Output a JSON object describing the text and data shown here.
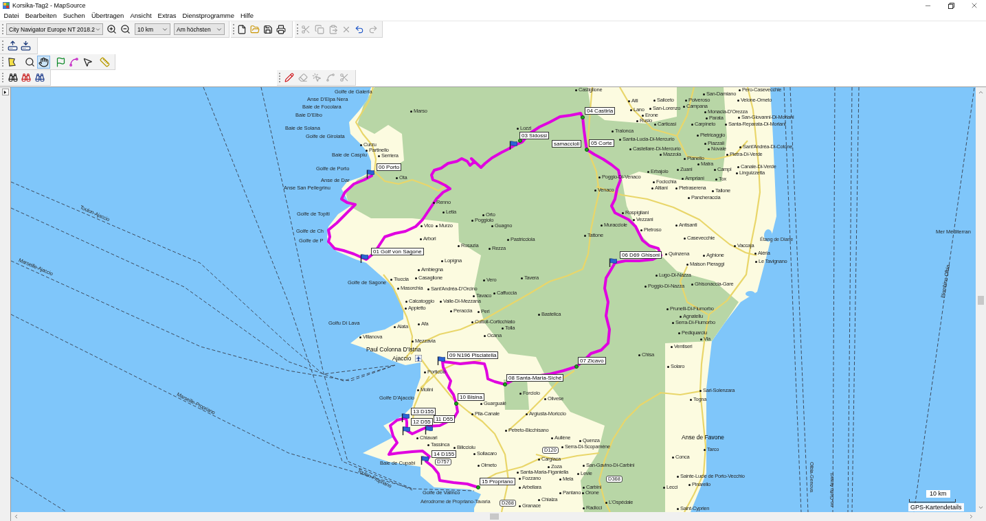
{
  "window": {
    "title": "Korsika-Tag2 - MapSource"
  },
  "menu": [
    "Datei",
    "Bearbeiten",
    "Suchen",
    "Übertragen",
    "Ansicht",
    "Extras",
    "Dienstprogramme",
    "Hilfe"
  ],
  "toolbar": {
    "map_product": "City Navigator Europe NT 2018.2",
    "zoom_scale": "10 km",
    "detail": "Am höchsten"
  },
  "edit_tools": [
    {
      "disabled": true
    },
    {
      "disabled": true
    },
    {
      "disabled": true
    },
    {
      "disabled": true
    },
    {
      "disabled": false
    },
    {
      "disabled": true
    }
  ],
  "map_tools": [
    {
      "selected": false
    },
    {
      "selected": false
    },
    {
      "selected": true
    },
    {
      "selected": false
    },
    {
      "selected": false
    },
    {
      "selected": false
    },
    {
      "selected": false
    }
  ],
  "track_tools": [
    {
      "disabled": false
    },
    {
      "disabled": true
    },
    {
      "disabled": true
    },
    {
      "disabled": true
    },
    {
      "disabled": true
    }
  ],
  "map": {
    "ferry_routes": [
      "Toulon-Ajaccio",
      "Marseille-Ajaccio",
      "Marseille-Propriano",
      "Toulon-Propriano",
      "Olbia-Genova",
      "no-Golfo Aranci",
      "Piombino-Olbia"
    ],
    "area_labels": [
      {
        "text": "Golfe de Galeria",
        "kind": "water"
      },
      {
        "text": "Anse D'Elpa Nera",
        "kind": "water"
      },
      {
        "text": "Baie de Focolara",
        "kind": "water"
      },
      {
        "text": "Baie D'Elbo",
        "kind": "water"
      },
      {
        "text": "Baie de Solana",
        "kind": "water"
      },
      {
        "text": "Golfe de Girolata",
        "kind": "water"
      },
      {
        "text": "Baie de Caspiu",
        "kind": "water"
      },
      {
        "text": "Golfe de Porto",
        "kind": "water"
      },
      {
        "text": "Anse de Dar",
        "kind": "water"
      },
      {
        "text": "Anse San Pellegrinu",
        "kind": "water"
      },
      {
        "text": "Golfe de Topiti",
        "kind": "water"
      },
      {
        "text": "Golfe de Ch",
        "kind": "water"
      },
      {
        "text": "Mer Méditerran",
        "kind": "water"
      },
      {
        "text": "Golfe de P",
        "kind": "water"
      },
      {
        "text": "Étang de Diane",
        "kind": "small"
      },
      {
        "text": "Golfe de Sagone",
        "kind": "water"
      },
      {
        "text": "Golfu Di Lava",
        "kind": "water"
      },
      {
        "text": "Paul Colonna D'Istria",
        "kind": "place"
      },
      {
        "text": "Ajaccio",
        "kind": "place"
      },
      {
        "text": "Golfe D'Ajaccio",
        "kind": "water"
      },
      {
        "text": "Anse de Favone",
        "kind": "place"
      },
      {
        "text": "Baie de Cupabi",
        "kind": "water"
      },
      {
        "text": "Golfe de Valinco",
        "kind": "water"
      },
      {
        "text": "Aérodrome de Propriano-Tavaria",
        "kind": "small"
      }
    ],
    "towns": [
      "Castiglione",
      "San-Damiano",
      "Pero-Casevecchie",
      "Aiti",
      "Saliceto",
      "Polveroso",
      "Velone-Orneto",
      "Marso",
      "Lano",
      "San-Lorenzo",
      "Campana",
      "Erone",
      "Monacia-D'Orezza",
      "Rusio",
      "Parata",
      "San-Giovanni-Di-Moriani",
      "Lozzi",
      "Carticasi",
      "Carpineto",
      "Santa-Reparata-Di-Moriani",
      "Tralonca",
      "Santa-Lucia-Di-Mercurio",
      "Pietricaggio",
      "Curzu",
      "Piazzali",
      "Partinello",
      "Castellare-Di-Mercurio",
      "Novale",
      "Sant'Andréa-Di-Cotone",
      "Serriera",
      "Mazzola",
      "Pianello",
      "Pietra-Di-Verde",
      "Matra",
      "Erbajolo",
      "Zuani",
      "Campi",
      "Canale-Di-Verde",
      "Ota",
      "Poggio-Di-Venaco",
      "Linguizzetta",
      "Focicchia",
      "Ampriani",
      "Tox",
      "Venaco",
      "Altiani",
      "Pietraserena",
      "Tallone",
      "Renno",
      "Pancheraccia",
      "Letia",
      "Orto",
      "Rospigliani",
      "Poggiolo",
      "Vezzani",
      "Vico",
      "Murzo",
      "Guagno",
      "Muracciole",
      "Pietroso",
      "Antisanti",
      "Arbori",
      "Pastricciola",
      "Tattone",
      "Casevecchie",
      "Rosazia",
      "Rezza",
      "Vaccaja",
      "Quinzena",
      "Aghione",
      "Aléria",
      "Lopigna",
      "Maison Pieraggi",
      "Le Tavignano",
      "Ambiegna",
      "Tiuccia",
      "Casaglione",
      "Vero",
      "Tavera",
      "Lugo-Di-Nazza",
      "Masorchia",
      "Sant'Andréa-D'Orcino",
      "Poggio-Di-Nazza",
      "Ghisonaccia-Gare",
      "Tavaco",
      "Caffuccia",
      "Calcatoggio",
      "Valle-Di-Mezzana",
      "Appietto",
      "Peraccia",
      "Peri",
      "Prunelli-Di-Fiumorbo",
      "Bastelica",
      "Agnatellu",
      "Alata",
      "Afa",
      "Cuttoli-Corticchiato",
      "Serra-Di-Fiumorbo",
      "Tolla",
      "Villanova",
      "Ocana",
      "Pediquarciu",
      "Mezzavia",
      "Via",
      "Ventiseri",
      "Chisa",
      "Solaro",
      "Porticcio",
      "Molini",
      "Forciolo",
      "Sari-Solenzara",
      "Guargualé",
      "Olivese",
      "Togna",
      "Pila-Canale",
      "Argiusta-Moriccio",
      "Petreto-Bicchisano",
      "Chiavari",
      "Aullène",
      "Tassinca",
      "Quenza",
      "Bilicciolu",
      "Serra-Di-Scopamène",
      "Sollacaro",
      "Tarco",
      "Cargiaca",
      "Conca",
      "Olmeto",
      "Zoza",
      "San-Gavino-Di-Carbini",
      "Santa-Maria-Figaniella",
      "Fozzano",
      "Levie",
      "Mela",
      "Sainte-Lucie de Porto-Vecchio",
      "Arbellara",
      "Carbini",
      "Lecci",
      "Pinarello",
      "Pantano",
      "Orone",
      "Chialza",
      "Granace",
      "L'Ospédale",
      "Radicci",
      "Saint-Cyprien"
    ],
    "road_numbers": [
      "D120",
      "D757",
      "D368",
      "D268"
    ],
    "waypoints": [
      {
        "label": "00 Porto",
        "kind": "flag"
      },
      {
        "label": "01 Golf von Sagone",
        "kind": "flag"
      },
      {
        "label": "samaccioli",
        "kind": "flag"
      },
      {
        "label": "03 Sidossi",
        "kind": "dot"
      },
      {
        "label": "04 Castirla",
        "kind": "dot"
      },
      {
        "label": "05 Corte",
        "kind": "dot"
      },
      {
        "label": "06 D69 Ghisoni",
        "kind": "flag"
      },
      {
        "label": "07 Zicavo",
        "kind": "dot"
      },
      {
        "label": "08 Santa-Maria-Siché",
        "kind": "dot"
      },
      {
        "label": "09 N196 Pisciatella",
        "kind": "flag"
      },
      {
        "label": "10 Bisina",
        "kind": "dot"
      },
      {
        "label": "13 D155",
        "kind": "flag"
      },
      {
        "label": "12 D55",
        "kind": "flag"
      },
      {
        "label": "11 D55",
        "kind": "flag"
      },
      {
        "label": "14 D155",
        "kind": "flag"
      },
      {
        "label": "15 Propriano",
        "kind": "dot"
      }
    ],
    "scale": "10 km",
    "details_label": "GPS-Kartendetails"
  }
}
